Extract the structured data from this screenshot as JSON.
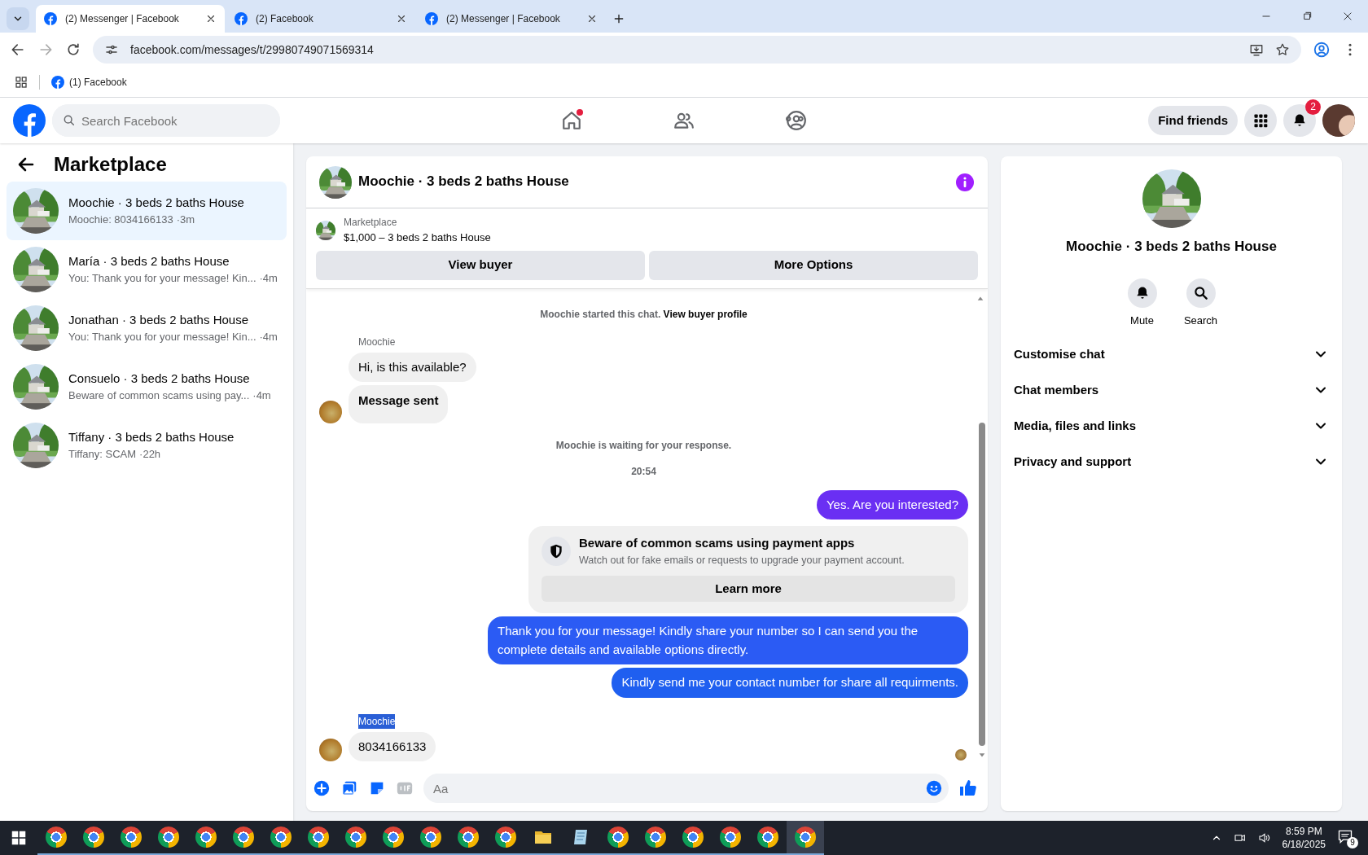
{
  "browser": {
    "tabs": [
      {
        "title": "(2) Messenger | Facebook",
        "selected": true
      },
      {
        "title": "(2) Facebook",
        "selected": false
      },
      {
        "title": "(2) Messenger | Facebook",
        "selected": false
      }
    ],
    "url": "facebook.com/messages/t/29980749071569314",
    "bookmarks": [
      {
        "label": "(1) Facebook"
      }
    ]
  },
  "header": {
    "search_placeholder": "Search Facebook",
    "nav": [
      {
        "kind": "home",
        "dot": true
      },
      {
        "kind": "friends",
        "dot": false
      },
      {
        "kind": "groups",
        "dot": false
      }
    ],
    "find_friends": "Find friends",
    "notification_count": "2"
  },
  "sidebar": {
    "title": "Marketplace",
    "conversations": [
      {
        "name": "Moochie · 3 beds 2 baths House",
        "preview": "Moochie: 8034166133",
        "time": "·3m",
        "selected": true
      },
      {
        "name": "María · 3 beds 2 baths House",
        "preview": "You: Thank you for your message! Kin...",
        "time": "·4m",
        "selected": false
      },
      {
        "name": "Jonathan · 3 beds 2 baths House",
        "preview": "You: Thank you for your message! Kin...",
        "time": "·4m",
        "selected": false
      },
      {
        "name": "Consuelo · 3 beds 2 baths House",
        "preview": "Beware of common scams using pay...",
        "time": "·4m",
        "selected": false
      },
      {
        "name": "Tiffany · 3 beds 2 baths House",
        "preview": "Tiffany: SCAM",
        "time": "·22h",
        "selected": false
      }
    ]
  },
  "chat": {
    "title": "Moochie · 3 beds 2 baths House",
    "listing": {
      "source": "Marketplace",
      "price_title": "$1,000 – 3 beds 2 baths House"
    },
    "buttons": [
      "View buyer",
      "More Options"
    ],
    "messages": [
      {
        "kind": "system",
        "text": "Moochie started this chat.",
        "link": "View buyer profile"
      },
      {
        "kind": "sender",
        "text": "Moochie",
        "highlighted": false
      },
      {
        "kind": "incoming",
        "text": "Hi, is this available?",
        "bold": false,
        "avatar": false
      },
      {
        "kind": "incoming",
        "text": "Message sent",
        "bold": true,
        "avatar": true
      },
      {
        "kind": "system",
        "text": "Moochie is waiting for your response."
      },
      {
        "kind": "timestamp",
        "text": "20:54"
      },
      {
        "kind": "outgoing",
        "text": "Yes. Are you interested?",
        "color": "#6a2ff3"
      },
      {
        "kind": "warning",
        "title": "Beware of common scams using payment apps",
        "body": "Watch out for fake emails or requests to upgrade your payment account.",
        "button": "Learn more"
      },
      {
        "kind": "outgoing",
        "text": "Thank you for your message! Kindly share your number so I can send you the complete details and available options directly.",
        "color": "#2b5bf4"
      },
      {
        "kind": "outgoing",
        "text": "Kindly send me your contact number for share all requirments.",
        "color": "#1f5ff0"
      },
      {
        "kind": "sender",
        "text": "Moochie",
        "highlighted": true
      },
      {
        "kind": "incoming",
        "text": "8034166133",
        "bold": false,
        "avatar": true
      }
    ],
    "read_receipt": true,
    "composer_placeholder": "Aa"
  },
  "details": {
    "title": "Moochie · 3 beds 2 baths House",
    "actions": [
      {
        "kind": "mute",
        "label": "Mute"
      },
      {
        "kind": "search",
        "label": "Search"
      }
    ],
    "sections": [
      {
        "label": "Customise chat",
        "expanded": false
      },
      {
        "label": "Chat members",
        "expanded": false
      },
      {
        "label": "Media, files and links",
        "expanded": false
      },
      {
        "label": "Privacy and support",
        "expanded": false
      }
    ]
  },
  "taskbar": {
    "apps": [
      {
        "kind": "chrome",
        "selected": false
      },
      {
        "kind": "chrome",
        "selected": false
      },
      {
        "kind": "chrome",
        "selected": false
      },
      {
        "kind": "chrome",
        "selected": false
      },
      {
        "kind": "chrome",
        "selected": false
      },
      {
        "kind": "chrome",
        "selected": false
      },
      {
        "kind": "chrome",
        "selected": false
      },
      {
        "kind": "chrome",
        "selected": false
      },
      {
        "kind": "chrome",
        "selected": false
      },
      {
        "kind": "chrome",
        "selected": false
      },
      {
        "kind": "chrome",
        "selected": false
      },
      {
        "kind": "chrome",
        "selected": false
      },
      {
        "kind": "chrome",
        "selected": false
      },
      {
        "kind": "folder",
        "selected": false
      },
      {
        "kind": "notes",
        "selected": false
      },
      {
        "kind": "chrome",
        "selected": false
      },
      {
        "kind": "chrome",
        "selected": false
      },
      {
        "kind": "chrome",
        "selected": false
      },
      {
        "kind": "chrome",
        "selected": false
      },
      {
        "kind": "chrome",
        "selected": false
      },
      {
        "kind": "chrome",
        "selected": true
      }
    ],
    "time": "8:59 PM",
    "date": "6/18/2025",
    "notifications": "9"
  }
}
